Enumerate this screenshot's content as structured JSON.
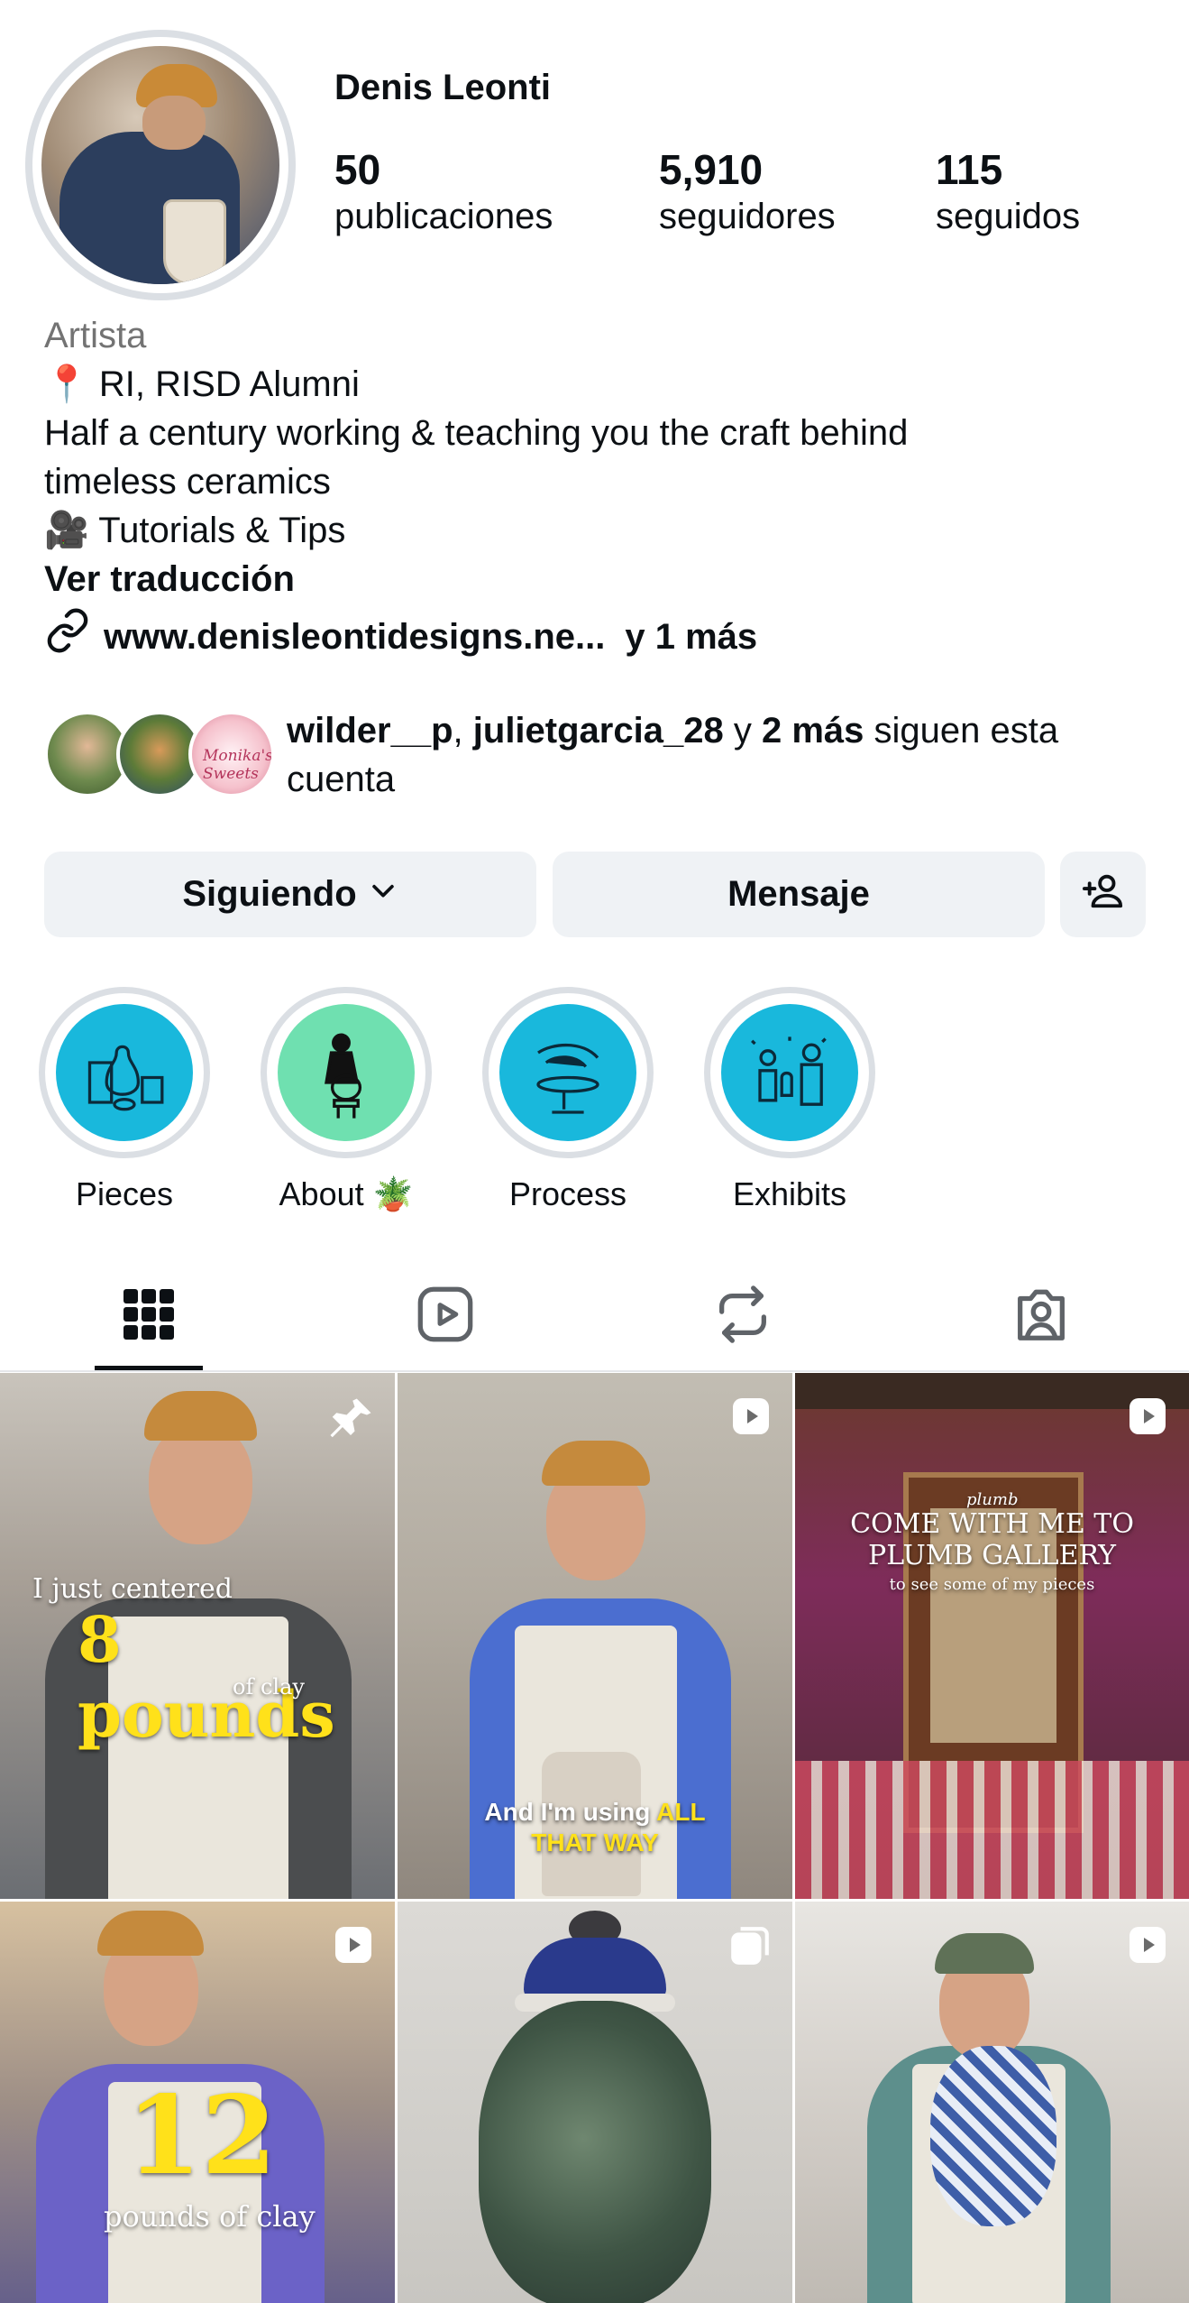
{
  "profile": {
    "display_name": "Denis Leonti",
    "stats": [
      {
        "value": "50",
        "label": "publicaciones"
      },
      {
        "value": "5,910",
        "label": "seguidores"
      },
      {
        "value": "115",
        "label": "seguidos"
      }
    ],
    "category": "Artista",
    "bio_lines": [
      "📍 RI, RISD Alumni",
      "Half a century working & teaching you the craft behind",
      "timeless ceramics",
      "🎥 Tutorials & Tips"
    ],
    "translate_link": "Ver traducción",
    "website": "www.denisleontidesigns.ne...",
    "website_more": "y 1 más"
  },
  "followed_by": {
    "user1": "wilder__p",
    "separator": ",",
    "user2": "julietgarcia_28",
    "connector": "y",
    "more": "2 más",
    "suffix": "siguen esta cuenta",
    "mini_avatar_text": "Monika's Sweets"
  },
  "buttons": {
    "following": "Siguiendo",
    "message": "Mensaje"
  },
  "highlights": [
    {
      "label": "Pieces"
    },
    {
      "label": "About 🪴"
    },
    {
      "label": "Process"
    },
    {
      "label": "Exhibits"
    }
  ],
  "tabs": [
    "grid-icon",
    "reels-icon",
    "reposts-icon",
    "tagged-icon"
  ],
  "posts": {
    "p1": {
      "line1": "I just centered",
      "big": "8 pounds",
      "small": "of clay"
    },
    "p2": {
      "line1": "And I'm using",
      "hl1": "ALL",
      "line2": "THAT WAY"
    },
    "p3": {
      "line1": "COME WITH ME TO",
      "line2": "PLUMB GALLERY",
      "line3": "to see some of my pieces",
      "sign": "plumb"
    },
    "p4": {
      "big": "12",
      "small": "pounds of clay"
    }
  },
  "colors": {
    "button_bg": "#eff2f5",
    "highlight_blue": "#19b8dc",
    "highlight_green": "#6fe0b0",
    "overlay_yellow": "#ffe11a"
  }
}
